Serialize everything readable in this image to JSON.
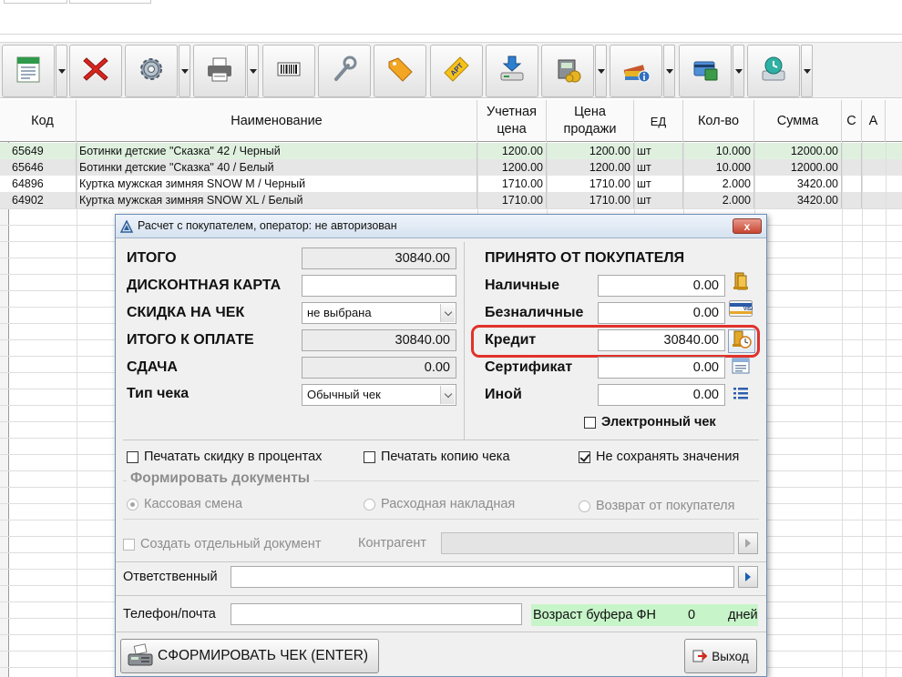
{
  "toolbar": {
    "buttons": [
      {
        "icon": "new-document-icon",
        "has_dropdown": true
      },
      {
        "icon": "delete-x-icon",
        "has_dropdown": false
      },
      {
        "icon": "gear-icon",
        "has_dropdown": true
      },
      {
        "icon": "printer-icon",
        "has_dropdown": true
      },
      {
        "icon": "barcode-icon",
        "has_dropdown": false
      },
      {
        "icon": "wrench-icon",
        "has_dropdown": false
      },
      {
        "icon": "price-tag-icon",
        "has_dropdown": false
      },
      {
        "icon": "article-tag-icon",
        "has_dropdown": false,
        "text": "АРТ"
      },
      {
        "icon": "download-scale-icon",
        "has_dropdown": false
      },
      {
        "icon": "cash-register-icon",
        "has_dropdown": true
      },
      {
        "icon": "books-info-icon",
        "has_dropdown": true
      },
      {
        "icon": "card-terminal-icon",
        "has_dropdown": true
      },
      {
        "icon": "disk-clock-icon",
        "has_dropdown": true
      }
    ]
  },
  "grid": {
    "columns": {
      "code": "Код",
      "name": "Наименование",
      "cost": "Учетная цена",
      "price": "Цена продажи",
      "unit": "ЕД",
      "qty": "Кол-во",
      "sum": "Сумма",
      "c": "С",
      "a": "А"
    },
    "rows": [
      {
        "code": "65649",
        "name": "Ботинки детские \"Сказка\" 42 / Черный",
        "cost": "1200.00",
        "price": "1200.00",
        "unit": "шт",
        "qty": "10.000",
        "sum": "12000.00",
        "selected": true
      },
      {
        "code": "65646",
        "name": "Ботинки детские \"Сказка\" 40 / Белый",
        "cost": "1200.00",
        "price": "1200.00",
        "unit": "шт",
        "qty": "10.000",
        "sum": "12000.00",
        "selected": false
      },
      {
        "code": "64896",
        "name": "Куртка мужская зимняя SNOW M / Черный",
        "cost": "1710.00",
        "price": "1710.00",
        "unit": "шт",
        "qty": "2.000",
        "sum": "3420.00",
        "selected": false
      },
      {
        "code": "64902",
        "name": "Куртка мужская зимняя SNOW XL / Белый",
        "cost": "1710.00",
        "price": "1710.00",
        "unit": "шт",
        "qty": "2.000",
        "sum": "3420.00",
        "selected": false
      }
    ]
  },
  "dialog": {
    "title": "Расчет с покупателем, оператор: не авторизован",
    "close_label": "x",
    "left": {
      "total_label": "ИТОГО",
      "total_value": "30840.00",
      "discount_card_label": "ДИСКОНТНАЯ КАРТА",
      "discount_card_value": "",
      "check_discount_label": "СКИДКА НА ЧЕК",
      "check_discount_value": "не выбрана",
      "total_to_pay_label": "ИТОГО К ОПЛАТЕ",
      "total_to_pay_value": "30840.00",
      "change_label": "СДАЧА",
      "change_value": "0.00",
      "receipt_type_label": "Тип чека",
      "receipt_type_value": "Обычный чек"
    },
    "right": {
      "header": "ПРИНЯТО ОТ ПОКУПАТЕЛЯ",
      "cash_label": "Наличные",
      "cash_value": "0.00",
      "cashless_label": "Безналичные",
      "cashless_value": "0.00",
      "credit_label": "Кредит",
      "credit_value": "30840.00",
      "certificate_label": "Сертификат",
      "certificate_value": "0.00",
      "other_label": "Иной",
      "other_value": "0.00",
      "electronic_check_label": "Электронный чек",
      "electronic_check_checked": false
    },
    "options": {
      "print_discount_percent": "Печатать скидку в процентах",
      "print_discount_percent_checked": false,
      "print_copy": "Печатать копию чека",
      "print_copy_checked": false,
      "dont_save": "Не сохранять значения",
      "dont_save_checked": true
    },
    "documents": {
      "group_title": "Формировать документы",
      "cash_shift": "Кассовая смена",
      "expense_invoice": "Расходная накладная",
      "customer_return": "Возврат от покупателя",
      "selected": "cash_shift"
    },
    "separate_doc_label": "Создать отдельный документ",
    "counterparty_label": "Контрагент",
    "counterparty_value": "",
    "responsible_label": "Ответственный",
    "responsible_value": "",
    "phone_label": "Телефон/почта",
    "phone_value": "",
    "buffer": {
      "label": "Возраст буфера ФН",
      "value": "0",
      "unit": "дней"
    },
    "make_receipt_button": "СФОРМИРОВАТЬ ЧЕК (ENTER)",
    "exit_button": "Выход"
  },
  "colors": {
    "selected_row": "#dff0df",
    "alt_row": "#e6e6e6",
    "credit_highlight": "#e0322b",
    "buffer_bg": "#c7f5c9",
    "title_bar": "#d6e2f0"
  }
}
